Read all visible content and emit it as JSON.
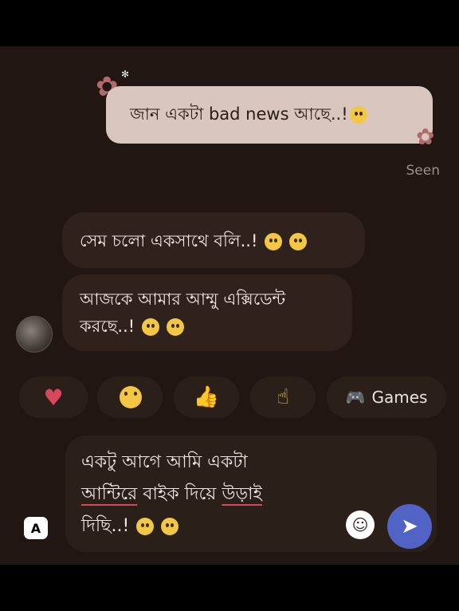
{
  "messages": {
    "outgoing": {
      "text": "জান একটা bad news আছে..!"
    },
    "status": "Seen",
    "incoming": [
      {
        "text": "সেম চলো একসাথে বলি..!"
      },
      {
        "line1": "আজকে আমার আম্মু এক্সিডেন্ট",
        "line2": "করছে..!"
      }
    ]
  },
  "reactions": {
    "heart_icon": "heart-icon",
    "laugh_icon": "laughing-crying-icon",
    "like_icon": "thumbs-up-icon",
    "point_icon": "pointing-hand-icon",
    "games_label": "Games"
  },
  "composer": {
    "line1": "একটু আগে আমি একটা",
    "line2a": "আন্টিরে",
    "line2b": " বাইক দিয়ে ",
    "line2c": "উড়াই",
    "line3": "দিছি..!",
    "keyboard_key": "A"
  }
}
